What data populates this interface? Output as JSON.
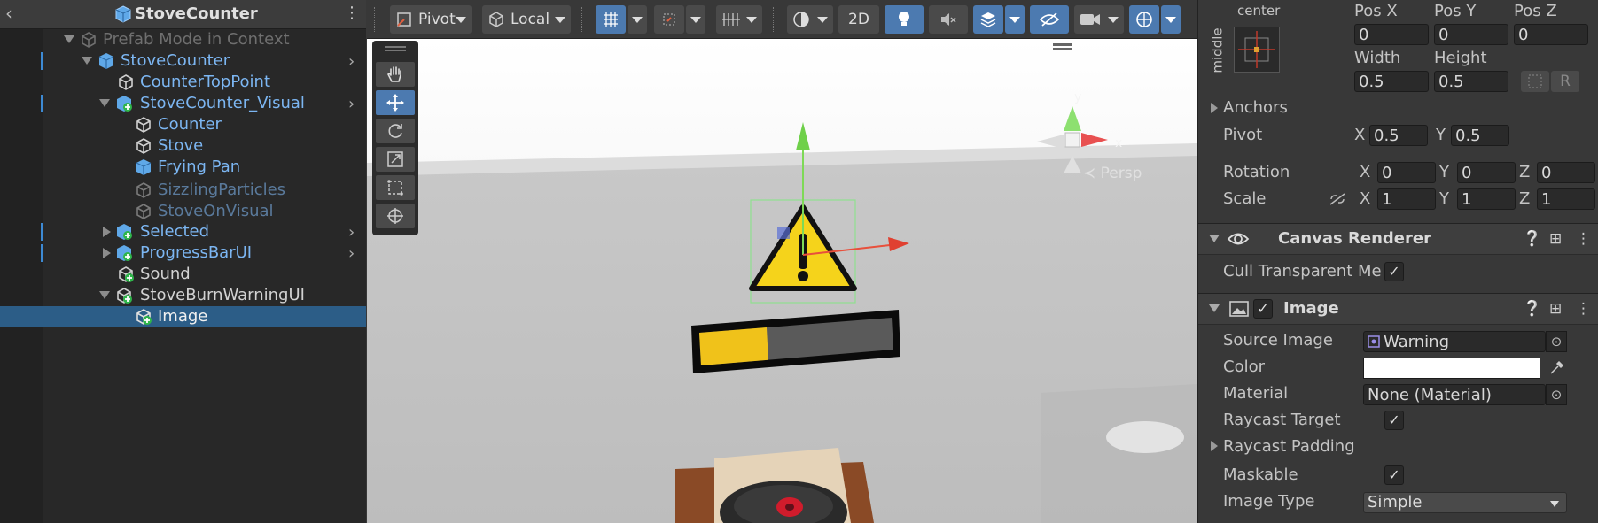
{
  "hierarchy": {
    "title": "StoveCounter",
    "items": [
      {
        "label": "Prefab Mode in Context",
        "style": "grey"
      },
      {
        "label": "StoveCounter",
        "style": "blue"
      },
      {
        "label": "CounterTopPoint",
        "style": "blue"
      },
      {
        "label": "StoveCounter_Visual",
        "style": "blue"
      },
      {
        "label": "Counter",
        "style": "blue"
      },
      {
        "label": "Stove",
        "style": "blue"
      },
      {
        "label": "Frying Pan",
        "style": "blue"
      },
      {
        "label": "SizzlingParticles",
        "style": "dim"
      },
      {
        "label": "StoveOnVisual",
        "style": "dim"
      },
      {
        "label": "Selected",
        "style": "blue"
      },
      {
        "label": "ProgressBarUI",
        "style": "blue"
      },
      {
        "label": "Sound",
        "style": "white"
      },
      {
        "label": "StoveBurnWarningUI",
        "style": "white"
      },
      {
        "label": "Image",
        "style": "white"
      }
    ]
  },
  "scene_toolbar": {
    "pivot_label": "Pivot",
    "local_label": "Local",
    "mode_2d_label": "2D"
  },
  "scene": {
    "persp_label": "Persp",
    "gizmo_axes": [
      "y",
      "x"
    ],
    "progress": 0.35,
    "colors": {
      "progress_fill": "#f0c21a",
      "progress_bg": "#5a5a5a",
      "warning_yellow": "#f5d31b"
    }
  },
  "inspector": {
    "rect_transform": {
      "anchor_h": "center",
      "anchor_v": "middle",
      "pos_x_label": "Pos X",
      "pos_y_label": "Pos Y",
      "pos_z_label": "Pos Z",
      "pos_x": "0",
      "pos_y": "0",
      "pos_z": "0",
      "width_label": "Width",
      "height_label": "Height",
      "width": "0.5",
      "height": "0.5",
      "r_button": "R",
      "anchors_label": "Anchors",
      "pivot_label": "Pivot",
      "pivot_x": "0.5",
      "pivot_y": "0.5",
      "rotation_label": "Rotation",
      "rotation": [
        "0",
        "0",
        "0"
      ],
      "scale_label": "Scale",
      "scale": [
        "1",
        "1",
        "1"
      ],
      "axis_x": "X",
      "axis_y": "Y",
      "axis_z": "Z"
    },
    "canvas_renderer": {
      "title": "Canvas Renderer",
      "cull_label": "Cull Transparent Me",
      "cull_checked": "✓"
    },
    "image": {
      "title": "Image",
      "enabled_check": "✓",
      "source_image_label": "Source Image",
      "source_image_value": "Warning",
      "color_label": "Color",
      "color_value": "#ffffff",
      "material_label": "Material",
      "material_value": "None (Material)",
      "raycast_target_label": "Raycast Target",
      "raycast_target_check": "✓",
      "raycast_padding_label": "Raycast Padding",
      "maskable_label": "Maskable",
      "maskable_check": "✓",
      "image_type_label": "Image Type",
      "image_type_value": "Simple"
    }
  }
}
